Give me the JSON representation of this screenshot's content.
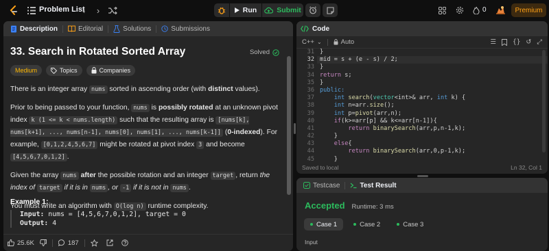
{
  "topbar": {
    "problem_list": "Problem List",
    "run": "Run",
    "submit": "Submit",
    "fire_count": "0",
    "premium": "Premium"
  },
  "colors": {
    "accent": "#ffa116",
    "green": "#2cbb5d",
    "medium": "#ffb800",
    "panel": "#262626",
    "bg": "#0f0f0f"
  },
  "left": {
    "tabs": [
      {
        "label": "Description",
        "icon": "document-icon"
      },
      {
        "label": "Editorial",
        "icon": "book-icon"
      },
      {
        "label": "Solutions",
        "icon": "flask-icon"
      },
      {
        "label": "Submissions",
        "icon": "history-icon"
      }
    ],
    "title": "33. Search in Rotated Sorted Array",
    "solved": "Solved",
    "difficulty": "Medium",
    "topics": "Topics",
    "companies": "Companies",
    "p1": {
      "a": "There is an integer array ",
      "c1": "nums",
      "b": " sorted in ascending order (with ",
      "bold": "distinct",
      "d": " values)."
    },
    "p2": {
      "a": "Prior to being passed to your function, ",
      "c1": "nums",
      "b": " is ",
      "bold1": "possibly rotated",
      "c": " at an unknown pivot index ",
      "c2": "k (1 <= k < nums.length)",
      "d": " such that the resulting array is ",
      "c3": "[nums[k], nums[k+1], ..., nums[n-1], nums[0], nums[1], ..., nums[k-1]]",
      "e": " (",
      "bold2": "0-indexed",
      "f": "). For example, ",
      "c4": "[0,1,2,4,5,6,7]",
      "g": " might be rotated at pivot index ",
      "c5": "3",
      "h": " and become ",
      "c6": "[4,5,6,7,0,1,2]",
      "i": "."
    },
    "p3": {
      "a": "Given the array ",
      "c1": "nums",
      "bold": " after",
      "b": " the possible rotation and an integer ",
      "c2": "target",
      "c": ", return ",
      "it1": "the index of",
      "c3": "target",
      "it2": " if it is in ",
      "c4": "nums",
      "it3": ", or ",
      "c5": "-1",
      "it4": " if it is not in ",
      "c6": "nums",
      "d": "."
    },
    "p4": {
      "a": "You must write an algorithm with ",
      "c1": "O(log n)",
      "b": " runtime complexity."
    },
    "example_title": "Example 1:",
    "example_input_label": "Input:",
    "example_input": "nums = [4,5,6,7,0,1,2], target = 0",
    "example_output_label": "Output:",
    "example_output": "4",
    "footer": {
      "likes": "25.6K",
      "comments": "187"
    }
  },
  "code": {
    "title": "Code",
    "language": "C++",
    "auto": "Auto",
    "saved": "Saved to local",
    "cursor": "Ln 32, Col 1",
    "line_numbers": [
      "31",
      "32",
      "33",
      "34",
      "35",
      "36",
      "37",
      "38",
      "39",
      "40",
      "41",
      "42",
      "43",
      "44",
      "45"
    ],
    "lines": {
      "l31": "}",
      "l32": "mid = s + (e - s) / 2;",
      "l33": "}",
      "l34a": "return",
      "l34b": " s;",
      "l35": "}",
      "l36": "public:",
      "l37a": "    int ",
      "l37b": "search",
      "l37c": "(",
      "l37d": "vector",
      "l37e": "<int>& arr, ",
      "l37f": "int",
      "l37g": " k) {",
      "l38a": "    int ",
      "l38b": "n=arr.",
      "l38c": "size",
      "l38d": "();",
      "l39a": "    int ",
      "l39b": "p=",
      "l39c": "pivot",
      "l39d": "(arr,n);",
      "l40a": "    if",
      "l40b": "(k>=arr[p] && k<=arr[n-1]){",
      "l41a": "        return ",
      "l41b": "binarySearch",
      "l41c": "(arr,p,n-1,k);",
      "l42": "    }",
      "l43a": "    else",
      "l43b": "{",
      "l44a": "        return ",
      "l44b": "binarySearch",
      "l44c": "(arr,0,p-1,k);",
      "l45": "    }"
    }
  },
  "result": {
    "tabs": [
      "Testcase",
      "Test Result"
    ],
    "status": "Accepted",
    "runtime": "Runtime: 3 ms",
    "cases": [
      "Case 1",
      "Case 2",
      "Case 3"
    ],
    "input_label": "Input"
  }
}
